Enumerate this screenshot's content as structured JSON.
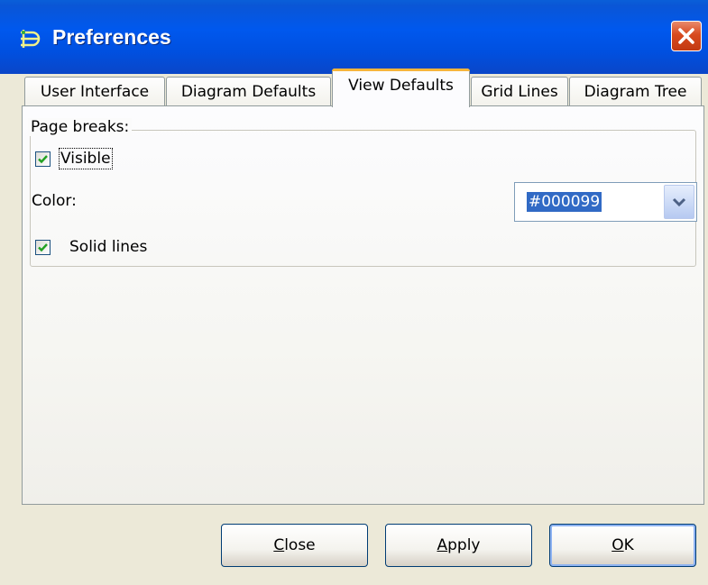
{
  "window": {
    "title": "Preferences",
    "titlebar_color": "#0058ee",
    "close_color": "#d84a1e"
  },
  "tabs": [
    {
      "label": "User Interface",
      "active": false
    },
    {
      "label": "Diagram Defaults",
      "active": false
    },
    {
      "label": "View Defaults",
      "active": true
    },
    {
      "label": "Grid Lines",
      "active": false
    },
    {
      "label": "Diagram Tree",
      "active": false
    }
  ],
  "page_breaks": {
    "legend": "Page breaks:",
    "visible": {
      "label": "Visible",
      "checked": true
    },
    "color": {
      "label": "Color:",
      "value": "#000099"
    },
    "solid_lines": {
      "label": "Solid lines",
      "checked": true
    }
  },
  "buttons": {
    "close": {
      "mnemonic": "C",
      "rest": "lose"
    },
    "apply": {
      "mnemonic": "A",
      "rest": "pply"
    },
    "ok": {
      "mnemonic": "O",
      "rest": "K"
    }
  },
  "icons": {
    "app": "diagram-app-icon",
    "close": "close-icon",
    "checkmark": "checkmark-icon",
    "dropdown": "chevron-down-icon"
  }
}
